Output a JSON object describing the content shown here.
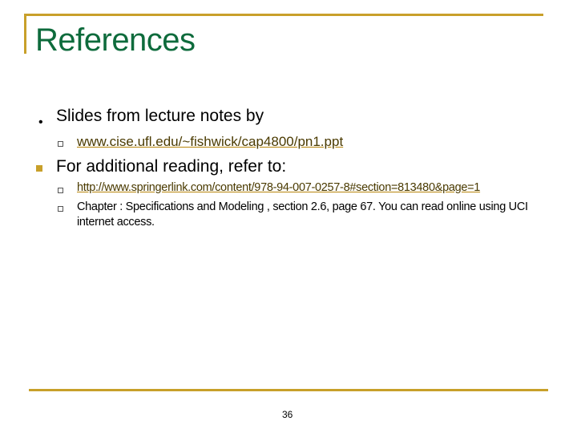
{
  "title": "References",
  "bullets": [
    {
      "text": "Slides from lecture notes by",
      "sub": [
        {
          "text": "www.cise.ufl.edu/~fishwick/cap4800/pn1.ppt",
          "link": true
        }
      ]
    },
    {
      "text": "For additional reading, refer to:",
      "sub": [
        {
          "text": "http://www.springerlink.com/content/978-94-007-0257-8#section=813480&page=1",
          "link": true
        },
        {
          "text": "Chapter : Specifications and Modeling , section 2.6, page 67. You can read online using UCI internet access.",
          "link": false
        }
      ]
    }
  ],
  "page_number": "36",
  "colors": {
    "accent": "#C8A02A",
    "title": "#0E6B3C"
  }
}
